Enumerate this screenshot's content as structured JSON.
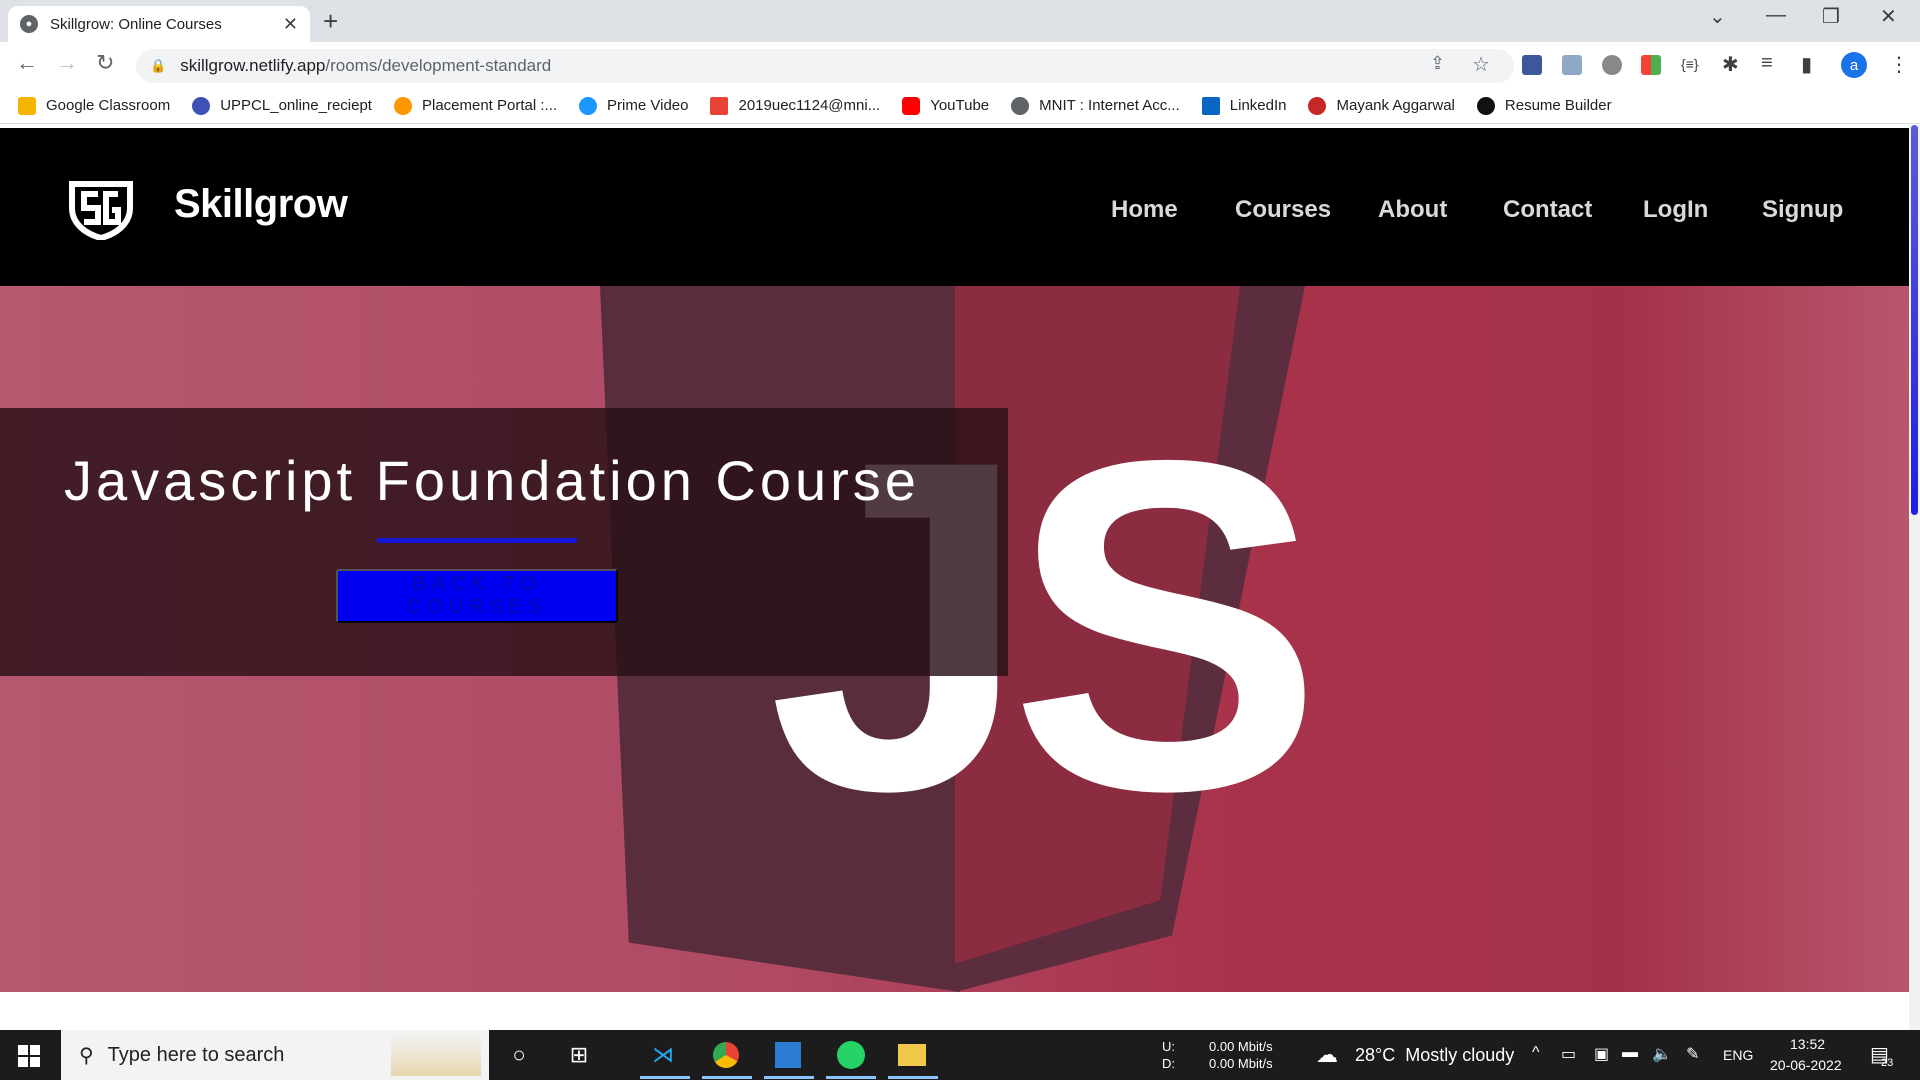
{
  "browser": {
    "tab_title": "Skillgrow: Online Courses",
    "url_domain": "skillgrow.netlify.app",
    "url_path": "/rooms/development-standard",
    "profile_initial": "a",
    "bookmarks": [
      {
        "label": "Google Classroom",
        "color": "#f4b400"
      },
      {
        "label": "UPPCL_online_reciept",
        "color": "#3f51b5"
      },
      {
        "label": "Placement Portal :...",
        "color": "#ff9800"
      },
      {
        "label": "Prime Video",
        "color": "#1a98ff"
      },
      {
        "label": "2019uec1124@mni...",
        "color": "#ea4335"
      },
      {
        "label": "YouTube",
        "color": "#ff0000"
      },
      {
        "label": "MNIT : Internet Acc...",
        "color": "#5f6368"
      },
      {
        "label": "LinkedIn",
        "color": "#0a66c2"
      },
      {
        "label": "Mayank Aggarwal",
        "color": "#c62828"
      },
      {
        "label": "Resume Builder",
        "color": "#111111"
      }
    ]
  },
  "site": {
    "brand": "Skillgrow",
    "nav": [
      "Home",
      "Courses",
      "About",
      "Contact",
      "LogIn",
      "Signup"
    ],
    "hero_badge": "JS",
    "hero_title": "Javascript Foundation Course",
    "back_button": "BACK TO COURSES"
  },
  "taskbar": {
    "search_placeholder": "Type here to search",
    "net_up_label": "U:",
    "net_down_label": "D:",
    "net_up": "0.00 Mbit/s",
    "net_down": "0.00 Mbit/s",
    "weather": "28°C  Mostly cloudy",
    "language": "ENG",
    "time": "13:52",
    "date": "20-06-2022",
    "notifications": "23"
  }
}
